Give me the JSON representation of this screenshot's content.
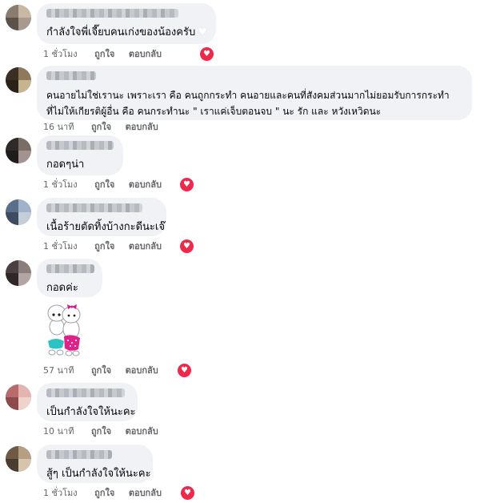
{
  "comments": [
    {
      "text": "กำลังใจพี่เจี๊ยบคนเก่งของน้องครับ",
      "text_trailing_icon": "white-heart-icon",
      "time": "1 ชั่วโมง",
      "like": "ถูกใจ",
      "reply": "ตอบกลับ",
      "reaction": "love-reaction-icon",
      "avatar_colors": [
        "#8a7c6e",
        "#c9b8a6",
        "#5b524a",
        "#a89a8c"
      ]
    },
    {
      "text_lines": [
        "คนอายไม่ใช่เรานะ เพราะเรา คือ คนถูกกระทำ คนอายและคนที่สังคมส่วนมากไม่ยอมรับการกระทำ",
        "ที่ไม่ให้เกียรติผู้อื่น คือ คนกระทำนะ \" เราแค่เจ็บตอนจบ \" นะ รัก และ หวังเหวิดนะ"
      ],
      "time": "16 นาที",
      "like": "ถูกใจ",
      "reply": "ตอบกลับ",
      "avatar_colors": [
        "#3b2f23",
        "#8e7a5a",
        "#2a2118",
        "#c7b48e"
      ]
    },
    {
      "text": "กอดๆน่า",
      "time": "1 ชั่วโมง",
      "like": "ถูกใจ",
      "reply": "ตอบกลับ",
      "reaction": "love-reaction-icon",
      "avatar_colors": [
        "#2e2a2a",
        "#7a6c66",
        "#1f1c1c",
        "#a39390"
      ]
    },
    {
      "text": "เนื้อร้ายตัดทิ้งบ้างกะดีนะเจ๊",
      "time": "1 ชั่วโมง",
      "like": "ถูกใจ",
      "reply": "ตอบกลับ",
      "reaction": "love-reaction-icon",
      "avatar_colors": [
        "#5a6f8a",
        "#9fb2c9",
        "#3d4c5e",
        "#c4ced9"
      ]
    },
    {
      "text": "กอดค่ะ",
      "time": "57 นาที",
      "like": "ถูกใจ",
      "reply": "ตอบกลับ",
      "reaction": "love-reaction-icon",
      "sticker": "hugging-characters-sticker",
      "avatar_colors": [
        "#4a4040",
        "#8b7d7a",
        "#2e2727",
        "#b3a5a2"
      ]
    },
    {
      "text": "เป็นกำลังใจให้นะคะ",
      "time": "10 นาที",
      "like": "ถูกใจ",
      "reply": "ตอบกลับ",
      "avatar_colors": [
        "#b96a6a",
        "#e3b5b0",
        "#8c4a4a",
        "#f0d2cc"
      ]
    },
    {
      "text": "สู้ๆ เป็นกำลังใจให้นะคะ",
      "time": "1 ชั่วโมง",
      "like": "ถูกใจ",
      "reply": "ตอบกลับ",
      "reaction": "love-reaction-icon",
      "avatar_colors": [
        "#6e5a45",
        "#b59e82",
        "#4a3c2e",
        "#d6c4ad"
      ]
    }
  ],
  "colors": {
    "bubble": "#f0f2f5",
    "meta_text": "#65676b",
    "love_reaction": "#f02849"
  }
}
